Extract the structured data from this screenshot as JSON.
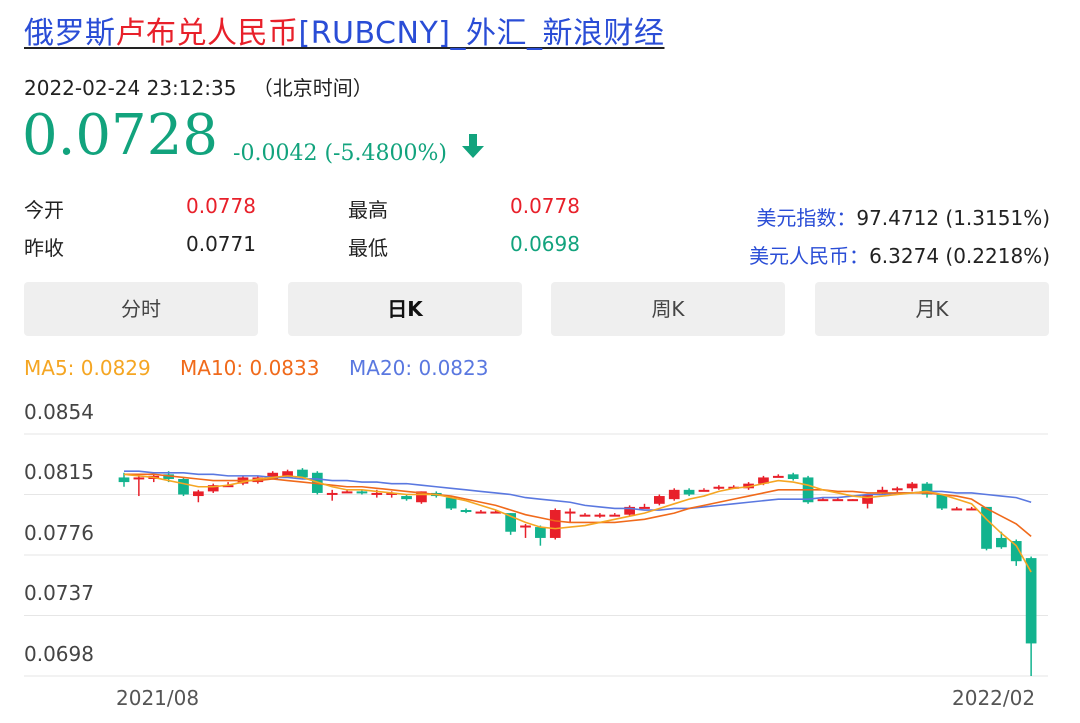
{
  "title": {
    "part1": "俄罗斯",
    "part2": "卢布兑人民币",
    "part3": "[RUBCNY]_外汇_新浪财经"
  },
  "timestamp": "2022-02-24 23:12:35",
  "timestamp_note": "（北京时间）",
  "price": "0.0728",
  "change": "-0.0042 (-5.4800%)",
  "stats": {
    "open_label": "今开",
    "open": "0.0778",
    "prev_close_label": "昨收",
    "prev_close": "0.0771",
    "high_label": "最高",
    "high": "0.0778",
    "low_label": "最低",
    "low": "0.0698"
  },
  "indices": [
    {
      "label": "美元指数：",
      "value": "97.4712 (1.3151%)"
    },
    {
      "label": "美元人民币：",
      "value": "6.3274 (0.2218%)"
    }
  ],
  "tabs": [
    "分时",
    "日K",
    "周K",
    "月K"
  ],
  "active_tab": "日K",
  "ma": [
    {
      "label": "MA5: 0.0829",
      "color": "#f5a623"
    },
    {
      "label": "MA10: 0.0833",
      "color": "#f06a1b"
    },
    {
      "label": "MA20: 0.0823",
      "color": "#5a78e0"
    }
  ],
  "colors": {
    "up": "#e8202a",
    "down": "#12b38e",
    "accent": "#2a4dd6"
  },
  "chart_data": {
    "type": "candlestick",
    "y_ticks": [
      "0.0854",
      "0.0815",
      "0.0776",
      "0.0737",
      "0.0698"
    ],
    "ylim": [
      0.0698,
      0.0854
    ],
    "x_ticks": [
      "2021/08",
      "2022/02"
    ],
    "grid": true,
    "candles": [
      [
        0.0826,
        0.0823,
        0.0829,
        0.082
      ],
      [
        0.0826,
        0.0826,
        0.0828,
        0.0814
      ],
      [
        0.0825,
        0.0827,
        0.0828,
        0.0823
      ],
      [
        0.0828,
        0.0825,
        0.083,
        0.0823
      ],
      [
        0.0825,
        0.0815,
        0.0826,
        0.0814
      ],
      [
        0.0814,
        0.0817,
        0.0818,
        0.081
      ],
      [
        0.0817,
        0.0821,
        0.0822,
        0.0816
      ],
      [
        0.0821,
        0.0821,
        0.0823,
        0.082
      ],
      [
        0.0822,
        0.0826,
        0.0827,
        0.0821
      ],
      [
        0.0823,
        0.0826,
        0.0827,
        0.0822
      ],
      [
        0.0825,
        0.0829,
        0.083,
        0.0825
      ],
      [
        0.0826,
        0.083,
        0.0831,
        0.0826
      ],
      [
        0.0831,
        0.0826,
        0.0832,
        0.0825
      ],
      [
        0.0829,
        0.0816,
        0.083,
        0.0815
      ],
      [
        0.0816,
        0.0816,
        0.0818,
        0.0811
      ],
      [
        0.0816,
        0.0817,
        0.0818,
        0.0816
      ],
      [
        0.0817,
        0.0816,
        0.0818,
        0.0815
      ],
      [
        0.0816,
        0.0816,
        0.0818,
        0.0813
      ],
      [
        0.0816,
        0.0816,
        0.0817,
        0.0813
      ],
      [
        0.0814,
        0.0812,
        0.0815,
        0.0811
      ],
      [
        0.081,
        0.0817,
        0.0817,
        0.0809
      ],
      [
        0.0816,
        0.0814,
        0.0817,
        0.0813
      ],
      [
        0.0813,
        0.0806,
        0.0814,
        0.0805
      ],
      [
        0.0805,
        0.0804,
        0.0806,
        0.0803
      ],
      [
        0.0804,
        0.0804,
        0.0805,
        0.0803
      ],
      [
        0.0804,
        0.0804,
        0.0805,
        0.0803
      ],
      [
        0.0803,
        0.0791,
        0.0803,
        0.0789
      ],
      [
        0.0794,
        0.0795,
        0.0796,
        0.0787
      ],
      [
        0.0794,
        0.0787,
        0.0795,
        0.0782
      ],
      [
        0.0787,
        0.0805,
        0.0806,
        0.0786
      ],
      [
        0.0803,
        0.0804,
        0.0806,
        0.0797
      ],
      [
        0.0802,
        0.0802,
        0.0803,
        0.0801
      ],
      [
        0.0801,
        0.0802,
        0.0803,
        0.08
      ],
      [
        0.0802,
        0.0802,
        0.0803,
        0.0802
      ],
      [
        0.0802,
        0.0807,
        0.0808,
        0.0801
      ],
      [
        0.0807,
        0.0807,
        0.0809,
        0.0806
      ],
      [
        0.0809,
        0.0814,
        0.0815,
        0.0808
      ],
      [
        0.0812,
        0.0818,
        0.0819,
        0.0811
      ],
      [
        0.0818,
        0.0815,
        0.0819,
        0.0814
      ],
      [
        0.0818,
        0.0818,
        0.0819,
        0.0818
      ],
      [
        0.0819,
        0.082,
        0.0821,
        0.0818
      ],
      [
        0.082,
        0.082,
        0.0821,
        0.0819
      ],
      [
        0.0819,
        0.0822,
        0.0823,
        0.0818
      ],
      [
        0.0822,
        0.0826,
        0.0827,
        0.0821
      ],
      [
        0.0826,
        0.0827,
        0.0828,
        0.0826
      ],
      [
        0.0828,
        0.0825,
        0.0829,
        0.0824
      ],
      [
        0.0826,
        0.081,
        0.0827,
        0.0809
      ],
      [
        0.0812,
        0.0812,
        0.0813,
        0.0811
      ],
      [
        0.0811,
        0.0812,
        0.0813,
        0.0811
      ],
      [
        0.0811,
        0.0812,
        0.0812,
        0.0811
      ],
      [
        0.0809,
        0.0815,
        0.0815,
        0.0806
      ],
      [
        0.0816,
        0.0818,
        0.082,
        0.0815
      ],
      [
        0.0818,
        0.0819,
        0.082,
        0.0816
      ],
      [
        0.0819,
        0.0822,
        0.0823,
        0.0817
      ],
      [
        0.0822,
        0.0815,
        0.0823,
        0.0813
      ],
      [
        0.0815,
        0.0806,
        0.0815,
        0.0805
      ],
      [
        0.0806,
        0.0806,
        0.0807,
        0.0805
      ],
      [
        0.0806,
        0.0806,
        0.0807,
        0.0805
      ],
      [
        0.0807,
        0.078,
        0.0807,
        0.0779
      ],
      [
        0.0787,
        0.0781,
        0.0791,
        0.078
      ],
      [
        0.0785,
        0.0772,
        0.0786,
        0.0769
      ],
      [
        0.0774,
        0.0719,
        0.0775,
        0.0698
      ]
    ],
    "ma5": [
      0.0828,
      0.0827,
      0.0826,
      0.0824,
      0.0822,
      0.082,
      0.082,
      0.0821,
      0.0823,
      0.0825,
      0.0826,
      0.0827,
      0.0826,
      0.0823,
      0.082,
      0.0818,
      0.0818,
      0.0817,
      0.0816,
      0.0815,
      0.0815,
      0.0815,
      0.0813,
      0.0811,
      0.0808,
      0.0805,
      0.0801,
      0.0797,
      0.0794,
      0.0793,
      0.0794,
      0.0795,
      0.0797,
      0.0799,
      0.0801,
      0.0803,
      0.0806,
      0.0809,
      0.0812,
      0.0814,
      0.0817,
      0.0819,
      0.082,
      0.0822,
      0.0824,
      0.0823,
      0.0821,
      0.0818,
      0.0816,
      0.0814,
      0.0813,
      0.0814,
      0.0815,
      0.0816,
      0.0817,
      0.0815,
      0.0812,
      0.0809,
      0.0799,
      0.079,
      0.0782,
      0.0765
    ],
    "ma10": [
      0.0828,
      0.0828,
      0.0828,
      0.0827,
      0.0826,
      0.0825,
      0.0824,
      0.0824,
      0.0824,
      0.0824,
      0.0825,
      0.0824,
      0.0823,
      0.0822,
      0.0821,
      0.082,
      0.082,
      0.0819,
      0.0818,
      0.0817,
      0.0816,
      0.0815,
      0.0814,
      0.0812,
      0.081,
      0.0808,
      0.0805,
      0.0802,
      0.08,
      0.0798,
      0.0797,
      0.0797,
      0.0797,
      0.0797,
      0.0798,
      0.0799,
      0.0801,
      0.0803,
      0.0806,
      0.0808,
      0.081,
      0.0812,
      0.0814,
      0.0816,
      0.0818,
      0.0818,
      0.0818,
      0.0818,
      0.0817,
      0.0817,
      0.0816,
      0.0816,
      0.0816,
      0.0816,
      0.0816,
      0.0815,
      0.0814,
      0.0812,
      0.0806,
      0.0801,
      0.0796,
      0.0788
    ],
    "ma20": [
      0.083,
      0.083,
      0.0829,
      0.0829,
      0.0829,
      0.0828,
      0.0828,
      0.0827,
      0.0827,
      0.0827,
      0.0826,
      0.0826,
      0.0825,
      0.0825,
      0.0824,
      0.0824,
      0.0823,
      0.0823,
      0.0822,
      0.0822,
      0.0821,
      0.082,
      0.0819,
      0.0818,
      0.0817,
      0.0816,
      0.0815,
      0.0813,
      0.0812,
      0.0811,
      0.081,
      0.0808,
      0.0807,
      0.0806,
      0.0806,
      0.0805,
      0.0805,
      0.0806,
      0.0806,
      0.0807,
      0.0808,
      0.0809,
      0.081,
      0.0811,
      0.0812,
      0.0812,
      0.0812,
      0.0813,
      0.0813,
      0.0814,
      0.0815,
      0.0815,
      0.0816,
      0.0816,
      0.0817,
      0.0817,
      0.0816,
      0.0816,
      0.0815,
      0.0814,
      0.0813,
      0.081
    ]
  }
}
